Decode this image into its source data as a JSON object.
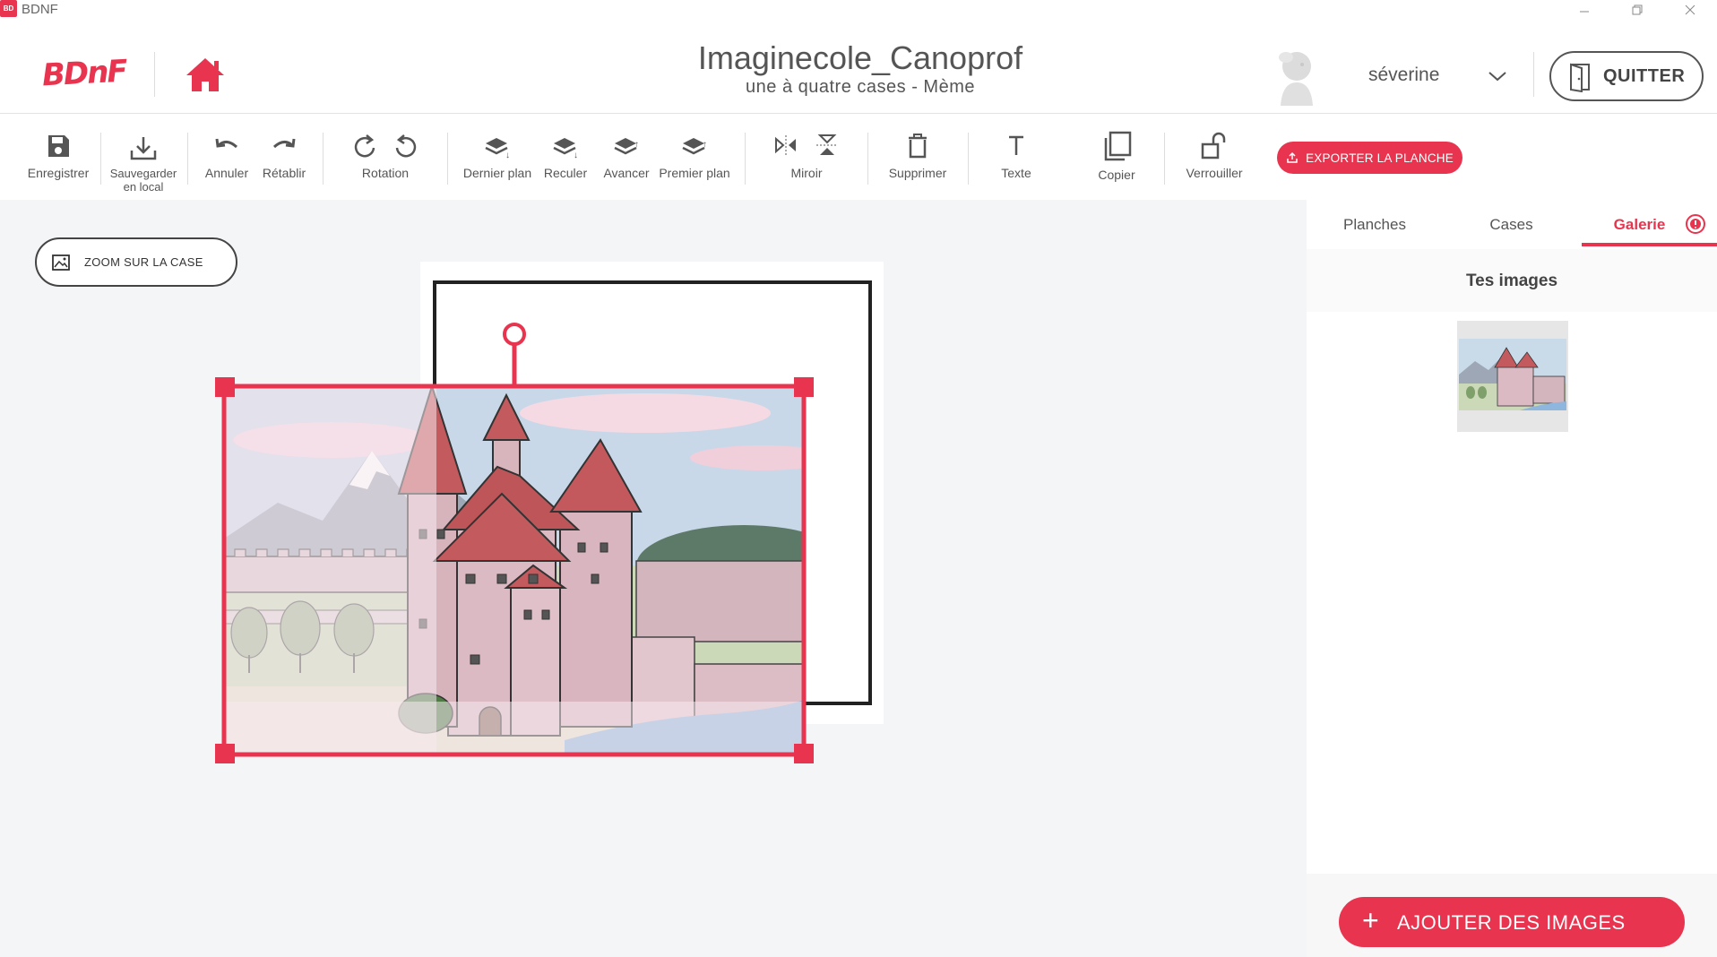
{
  "window": {
    "app_name": "BDNF",
    "icon_text": "BD"
  },
  "header": {
    "logo": "BDnF",
    "title": "Imaginecole_Canoprof",
    "subtitle": "une à quatre cases - Mème",
    "user_name": "séverine",
    "quit_label": "QUITTER"
  },
  "toolbar": {
    "save": "Enregistrer",
    "save_local_1": "Sauvegarder",
    "save_local_2": "en local",
    "undo": "Annuler",
    "redo": "Rétablir",
    "rotation": "Rotation",
    "back_most": "Dernier plan",
    "backward": "Reculer",
    "forward": "Avancer",
    "front_most": "Premier plan",
    "mirror": "Miroir",
    "delete": "Supprimer",
    "text": "Texte",
    "copy": "Copier",
    "lock": "Verrouiller",
    "export": "EXPORTER LA PLANCHE"
  },
  "workspace": {
    "zoom_label": "ZOOM SUR LA CASE"
  },
  "side_panel": {
    "tabs": [
      "Planches",
      "Cases",
      "Galerie"
    ],
    "active_tab": "Galerie",
    "heading": "Tes images",
    "add_label": "AJOUTER DES IMAGES"
  },
  "colors": {
    "accent": "#e8344e",
    "text": "#555555",
    "canvas_bg": "#f3f5f6"
  }
}
